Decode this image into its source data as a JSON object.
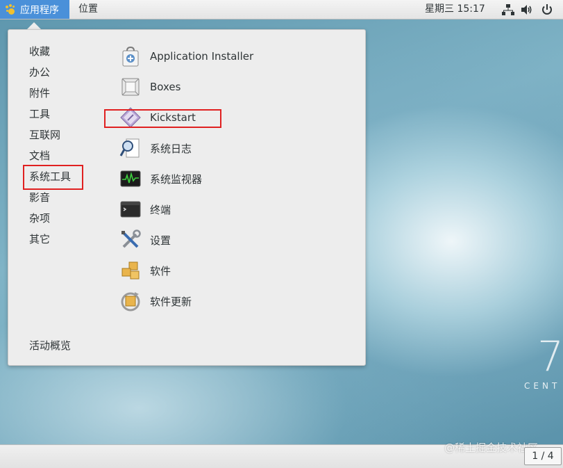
{
  "topbar": {
    "applications_label": "应用程序",
    "places_label": "位置",
    "clock": "星期三 15:17"
  },
  "menu": {
    "categories": [
      {
        "label": "收藏"
      },
      {
        "label": "办公"
      },
      {
        "label": "附件"
      },
      {
        "label": "工具"
      },
      {
        "label": "互联网"
      },
      {
        "label": "文档"
      },
      {
        "label": "系统工具",
        "selected": true
      },
      {
        "label": "影音"
      },
      {
        "label": "杂项"
      },
      {
        "label": "其它"
      }
    ],
    "apps": [
      {
        "label": "Application Installer",
        "icon": "software-installer-icon"
      },
      {
        "label": "Boxes",
        "icon": "boxes-icon"
      },
      {
        "label": "Kickstart",
        "icon": "kickstart-icon",
        "highlighted": true
      },
      {
        "label": "系统日志",
        "icon": "system-log-icon"
      },
      {
        "label": "系统监视器",
        "icon": "system-monitor-icon"
      },
      {
        "label": "终端",
        "icon": "terminal-icon"
      },
      {
        "label": "设置",
        "icon": "settings-icon"
      },
      {
        "label": "软件",
        "icon": "software-icon"
      },
      {
        "label": "软件更新",
        "icon": "software-update-icon"
      }
    ],
    "activities_label": "活动概览"
  },
  "desktop": {
    "logo_number": "7",
    "logo_text": "CENT"
  },
  "bottombar": {
    "workspace_pager": "1 / 4",
    "watermark": "@稀土掘金技术社区"
  },
  "colors": {
    "accent": "#4a90d9",
    "highlight_box": "#e02020"
  }
}
